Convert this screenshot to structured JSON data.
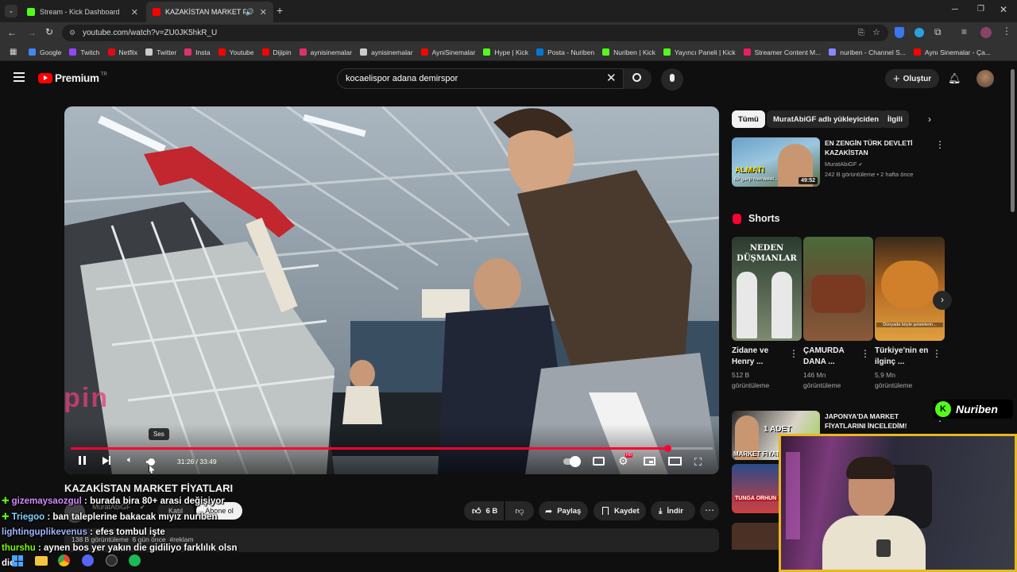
{
  "browser": {
    "tabs": [
      {
        "title": "Stream - Kick Dashboard",
        "color": "#53fc18"
      },
      {
        "title": "KAZAKİSTAN MARKET FİYATL",
        "color": "#ff0000"
      }
    ],
    "url": "youtube.com/watch?v=ZU0JK5hkR_U",
    "bookmarks": [
      {
        "label": "Google",
        "color": "#4285f4"
      },
      {
        "label": "Twitch",
        "color": "#9146ff"
      },
      {
        "label": "Netflix",
        "color": "#e50914"
      },
      {
        "label": "Twitter",
        "color": "#cccccc"
      },
      {
        "label": "Insta",
        "color": "#e1306c"
      },
      {
        "label": "Youtube",
        "color": "#ff0000"
      },
      {
        "label": "Dijipin",
        "color": "#ff0000"
      },
      {
        "label": "aynisinemalar",
        "color": "#e1306c"
      },
      {
        "label": "aynisinemalar",
        "color": "#cccccc"
      },
      {
        "label": "AyniSinemalar",
        "color": "#ff0000"
      },
      {
        "label": "Hype | Kick",
        "color": "#53fc18"
      },
      {
        "label": "Posta - Nuriben",
        "color": "#0078d4"
      },
      {
        "label": "Nuriben | Kick",
        "color": "#53fc18"
      },
      {
        "label": "Yayıncı Paneli | Kick",
        "color": "#53fc18"
      },
      {
        "label": "Streamer Content M...",
        "color": "#e91e63"
      },
      {
        "label": "nuriben - Channel S...",
        "color": "#8888ff"
      },
      {
        "label": "Aynı Sinemalar - Ça...",
        "color": "#ff0000"
      }
    ]
  },
  "youtube": {
    "logo": "Premium",
    "logo_sup": "TR",
    "search_value": "kocaelispor adana demirspor",
    "create_label": "Oluştur"
  },
  "player": {
    "time": "31:26 / 33:49",
    "tooltip": "Ses",
    "watermark": "dijipin",
    "progress": 0.93,
    "settings_badge": "HD"
  },
  "video": {
    "title": "KAZAKİSTAN MARKET FİYATLARI",
    "channel": "MuratAbiGF",
    "join": "Katıl",
    "subscribe": "Abone ol",
    "likes": "6 B",
    "share": "Paylaş",
    "save": "Kaydet",
    "download": "İndir",
    "views": "138 B görüntüleme  6 gün önce  #reklam"
  },
  "sidebar": {
    "chips": [
      "Tümü",
      "MuratAbiGF adlı yükleyiciden",
      "İlgili"
    ],
    "rec1": {
      "title": "EN ZENGİN TÜRK DEVLETİ KAZAKİSTAN",
      "channel": "MuratAbiGF",
      "meta": "242 B görüntüleme • 2 hafta önce",
      "duration": "49:52",
      "thumb_text": "ALMATI",
      "thumb_sub": "Bir garip memleket..."
    },
    "shorts_title": "Shorts",
    "shorts": [
      {
        "title": "Zidane ve Henry ...",
        "views": "512 B",
        "unit": "görüntüleme",
        "thumb_text": "NEDEN DÜŞMANLAR"
      },
      {
        "title": "ÇAMURDA DANA ...",
        "views": "146 Mn",
        "unit": "görüntüleme",
        "thumb_text": ""
      },
      {
        "title": "Türkiye'nin en ilginç ...",
        "views": "5,9 Mn",
        "unit": "görüntüleme",
        "thumb_text": "Dünyada böyle şelalelerin..."
      }
    ],
    "rec2": {
      "title": "JAPONYA'DA MARKET FİYATLARINI İNCELEDİM!",
      "thumb_text": "1 ADET",
      "thumb_sub": "MARKET FİYAT"
    },
    "rec3": {
      "thumb_text": "TUNGA ORHUN"
    }
  },
  "stream_overlay": {
    "brand": "Nuriben"
  },
  "chat": [
    {
      "user": "gizemaysaozgul",
      "msg": " : burada bira 80+ arasi değişiyor",
      "color": "#d48bff",
      "badge": true
    },
    {
      "user": "Triegoo",
      "msg": " : ban taleplerine bakacak mıyız nuriben",
      "color": "#7fd4ff",
      "badge": true
    },
    {
      "user": "lightinguplikevenus",
      "msg": " : efes tombul işte",
      "color": "#a0b4ff",
      "badge": false
    },
    {
      "user": "thurshu",
      "msg": " : aynen bos yer yakın die gidiliyo farklılık olsn",
      "color": "#7cfc00",
      "badge": false
    },
    {
      "user": "",
      "msg": "die",
      "color": "#ffffff",
      "badge": false
    }
  ]
}
